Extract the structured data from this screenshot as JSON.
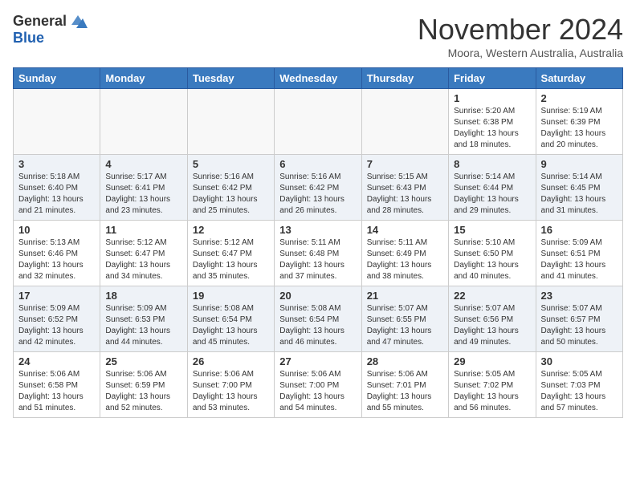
{
  "header": {
    "logo_general": "General",
    "logo_blue": "Blue",
    "month": "November 2024",
    "location": "Moora, Western Australia, Australia"
  },
  "days_of_week": [
    "Sunday",
    "Monday",
    "Tuesday",
    "Wednesday",
    "Thursday",
    "Friday",
    "Saturday"
  ],
  "weeks": [
    [
      {
        "day": "",
        "info": ""
      },
      {
        "day": "",
        "info": ""
      },
      {
        "day": "",
        "info": ""
      },
      {
        "day": "",
        "info": ""
      },
      {
        "day": "",
        "info": ""
      },
      {
        "day": "1",
        "info": "Sunrise: 5:20 AM\nSunset: 6:38 PM\nDaylight: 13 hours\nand 18 minutes."
      },
      {
        "day": "2",
        "info": "Sunrise: 5:19 AM\nSunset: 6:39 PM\nDaylight: 13 hours\nand 20 minutes."
      }
    ],
    [
      {
        "day": "3",
        "info": "Sunrise: 5:18 AM\nSunset: 6:40 PM\nDaylight: 13 hours\nand 21 minutes."
      },
      {
        "day": "4",
        "info": "Sunrise: 5:17 AM\nSunset: 6:41 PM\nDaylight: 13 hours\nand 23 minutes."
      },
      {
        "day": "5",
        "info": "Sunrise: 5:16 AM\nSunset: 6:42 PM\nDaylight: 13 hours\nand 25 minutes."
      },
      {
        "day": "6",
        "info": "Sunrise: 5:16 AM\nSunset: 6:42 PM\nDaylight: 13 hours\nand 26 minutes."
      },
      {
        "day": "7",
        "info": "Sunrise: 5:15 AM\nSunset: 6:43 PM\nDaylight: 13 hours\nand 28 minutes."
      },
      {
        "day": "8",
        "info": "Sunrise: 5:14 AM\nSunset: 6:44 PM\nDaylight: 13 hours\nand 29 minutes."
      },
      {
        "day": "9",
        "info": "Sunrise: 5:14 AM\nSunset: 6:45 PM\nDaylight: 13 hours\nand 31 minutes."
      }
    ],
    [
      {
        "day": "10",
        "info": "Sunrise: 5:13 AM\nSunset: 6:46 PM\nDaylight: 13 hours\nand 32 minutes."
      },
      {
        "day": "11",
        "info": "Sunrise: 5:12 AM\nSunset: 6:47 PM\nDaylight: 13 hours\nand 34 minutes."
      },
      {
        "day": "12",
        "info": "Sunrise: 5:12 AM\nSunset: 6:47 PM\nDaylight: 13 hours\nand 35 minutes."
      },
      {
        "day": "13",
        "info": "Sunrise: 5:11 AM\nSunset: 6:48 PM\nDaylight: 13 hours\nand 37 minutes."
      },
      {
        "day": "14",
        "info": "Sunrise: 5:11 AM\nSunset: 6:49 PM\nDaylight: 13 hours\nand 38 minutes."
      },
      {
        "day": "15",
        "info": "Sunrise: 5:10 AM\nSunset: 6:50 PM\nDaylight: 13 hours\nand 40 minutes."
      },
      {
        "day": "16",
        "info": "Sunrise: 5:09 AM\nSunset: 6:51 PM\nDaylight: 13 hours\nand 41 minutes."
      }
    ],
    [
      {
        "day": "17",
        "info": "Sunrise: 5:09 AM\nSunset: 6:52 PM\nDaylight: 13 hours\nand 42 minutes."
      },
      {
        "day": "18",
        "info": "Sunrise: 5:09 AM\nSunset: 6:53 PM\nDaylight: 13 hours\nand 44 minutes."
      },
      {
        "day": "19",
        "info": "Sunrise: 5:08 AM\nSunset: 6:54 PM\nDaylight: 13 hours\nand 45 minutes."
      },
      {
        "day": "20",
        "info": "Sunrise: 5:08 AM\nSunset: 6:54 PM\nDaylight: 13 hours\nand 46 minutes."
      },
      {
        "day": "21",
        "info": "Sunrise: 5:07 AM\nSunset: 6:55 PM\nDaylight: 13 hours\nand 47 minutes."
      },
      {
        "day": "22",
        "info": "Sunrise: 5:07 AM\nSunset: 6:56 PM\nDaylight: 13 hours\nand 49 minutes."
      },
      {
        "day": "23",
        "info": "Sunrise: 5:07 AM\nSunset: 6:57 PM\nDaylight: 13 hours\nand 50 minutes."
      }
    ],
    [
      {
        "day": "24",
        "info": "Sunrise: 5:06 AM\nSunset: 6:58 PM\nDaylight: 13 hours\nand 51 minutes."
      },
      {
        "day": "25",
        "info": "Sunrise: 5:06 AM\nSunset: 6:59 PM\nDaylight: 13 hours\nand 52 minutes."
      },
      {
        "day": "26",
        "info": "Sunrise: 5:06 AM\nSunset: 7:00 PM\nDaylight: 13 hours\nand 53 minutes."
      },
      {
        "day": "27",
        "info": "Sunrise: 5:06 AM\nSunset: 7:00 PM\nDaylight: 13 hours\nand 54 minutes."
      },
      {
        "day": "28",
        "info": "Sunrise: 5:06 AM\nSunset: 7:01 PM\nDaylight: 13 hours\nand 55 minutes."
      },
      {
        "day": "29",
        "info": "Sunrise: 5:05 AM\nSunset: 7:02 PM\nDaylight: 13 hours\nand 56 minutes."
      },
      {
        "day": "30",
        "info": "Sunrise: 5:05 AM\nSunset: 7:03 PM\nDaylight: 13 hours\nand 57 minutes."
      }
    ]
  ]
}
